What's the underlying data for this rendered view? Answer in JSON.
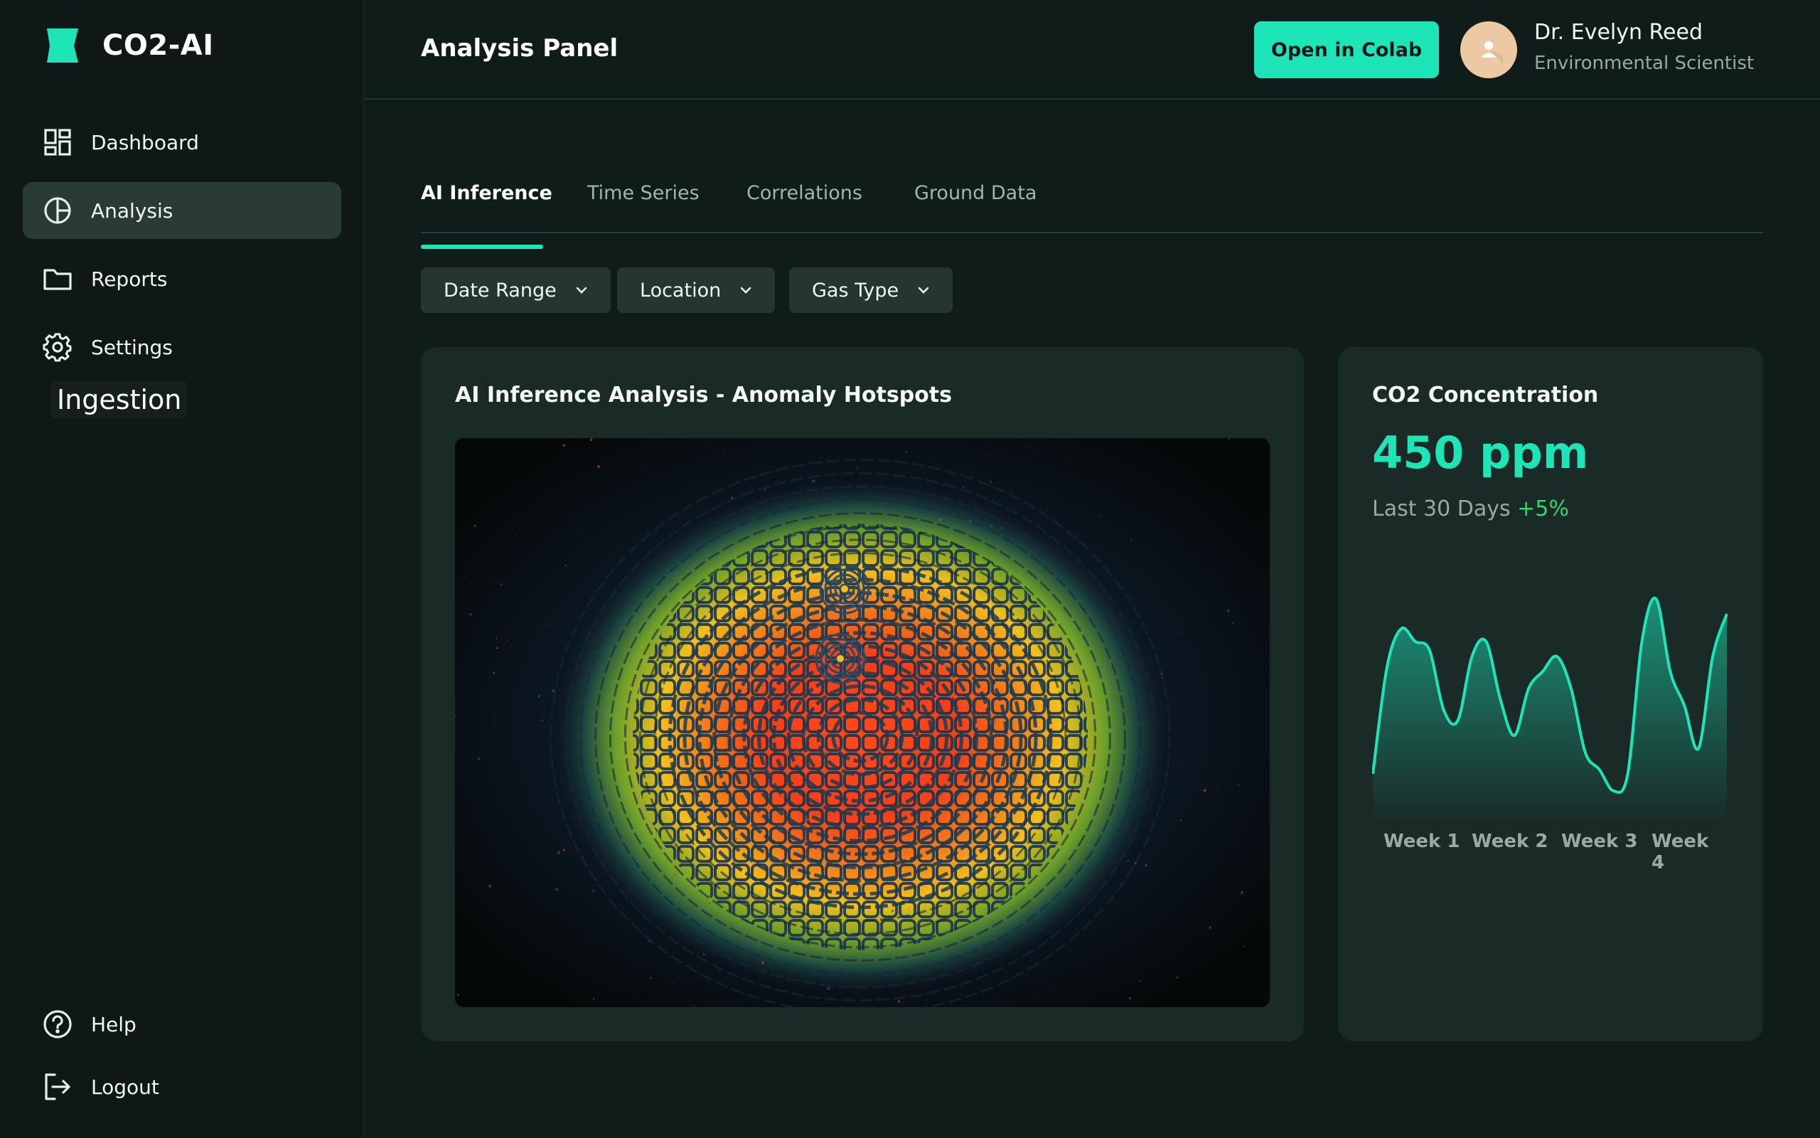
{
  "brand": {
    "name": "CO2-AI"
  },
  "colors": {
    "accent": "#1de5b8",
    "positive": "#2fd86b",
    "background": "#101c1a",
    "sidebar": "#0e1816",
    "card": "#1a2a27"
  },
  "sidebar": {
    "items": [
      {
        "label": "Dashboard",
        "icon": "dashboard-icon",
        "active": false
      },
      {
        "label": "Analysis",
        "icon": "pie-chart-icon",
        "active": true
      },
      {
        "label": "Reports",
        "icon": "folder-icon",
        "active": false
      },
      {
        "label": "Settings",
        "icon": "gear-icon",
        "active": false
      }
    ],
    "floating_label": "Ingestion",
    "bottom_items": [
      {
        "label": "Help",
        "icon": "help-icon"
      },
      {
        "label": "Logout",
        "icon": "logout-icon"
      }
    ]
  },
  "header": {
    "title": "Analysis Panel",
    "colab_button": "Open in Colab",
    "user": {
      "name": "Dr. Evelyn Reed",
      "role": "Environmental Scientist"
    }
  },
  "tabs": [
    {
      "label": "AI Inference",
      "active": true
    },
    {
      "label": "Time Series",
      "active": false
    },
    {
      "label": "Correlations",
      "active": false
    },
    {
      "label": "Ground Data",
      "active": false
    }
  ],
  "filters": [
    {
      "label": "Date Range",
      "icon": "chevron-down-icon"
    },
    {
      "label": "Location",
      "icon": "chevron-down-icon"
    },
    {
      "label": "Gas Type",
      "icon": "chevron-down-icon"
    }
  ],
  "main_card": {
    "title": "AI Inference Analysis - Anomaly Hotspots"
  },
  "side_card": {
    "title": "CO2 Concentration",
    "value": "450 ppm",
    "period": "Last 30 Days",
    "delta": "+5%"
  },
  "chart_data": {
    "type": "area",
    "categories": [
      "Week 1",
      "Week 2",
      "Week 3",
      "Week 4"
    ],
    "series": [
      {
        "values": [
          0.1,
          0.6,
          0.78,
          0.72,
          0.68,
          0.4,
          0.35,
          0.65,
          0.72,
          0.45,
          0.28,
          0.5,
          0.58,
          0.65,
          0.5,
          0.2,
          0.12,
          0.02,
          0.1,
          0.72,
          0.92,
          0.58,
          0.42,
          0.22,
          0.65,
          0.85
        ]
      }
    ],
    "title": "",
    "xlabel": "",
    "ylabel": "",
    "grid": false
  }
}
